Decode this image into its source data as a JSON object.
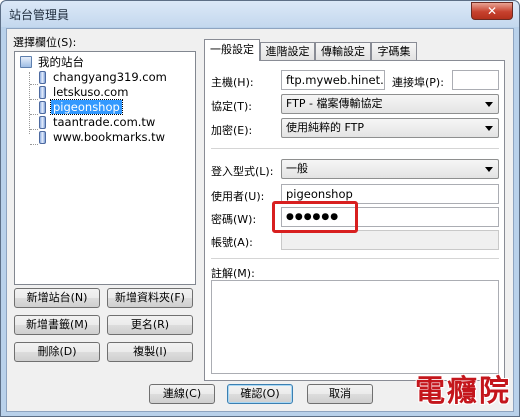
{
  "window": {
    "title": "站台管理員",
    "close_glyph": "✕"
  },
  "tree": {
    "label": "選擇欄位(S):",
    "root": "我的站台",
    "sites": [
      "changyang319.com",
      "letskuso.com",
      "pigeonshop",
      "taantrade.com.tw",
      "www.bookmarks.tw"
    ],
    "selected": "pigeonshop"
  },
  "left_buttons": {
    "new_site": "新增站台(N)",
    "new_folder": "新增資料夾(F)",
    "new_bookmark": "新增書籤(M)",
    "rename": "更名(R)",
    "delete": "刪除(D)",
    "copy": "複製(I)"
  },
  "tabs": [
    "一般設定",
    "進階設定",
    "傳輸設定",
    "字碼集"
  ],
  "general": {
    "host_label": "主機(H):",
    "host_value": "ftp.myweb.hinet.n",
    "port_label": "連接埠(P):",
    "port_value": "",
    "protocol_label": "協定(T):",
    "protocol_value": "FTP - 檔案傳輸協定",
    "encryption_label": "加密(E):",
    "encryption_value": "使用純粹的 FTP",
    "logon_label": "登入型式(L):",
    "logon_value": "一般",
    "user_label": "使用者(U):",
    "user_value": "pigeonshop",
    "password_label": "密碼(W):",
    "password_value": "●●●●●●",
    "account_label": "帳號(A):",
    "account_value": "",
    "comments_label": "註解(M):"
  },
  "bottom_buttons": {
    "connect": "連線(C)",
    "ok": "確認(O)",
    "cancel": "取消"
  },
  "watermark": "電癮院",
  "colors": {
    "selection": "#3399ff",
    "highlight": "#d81f1f",
    "watermark": "#c4161c"
  }
}
